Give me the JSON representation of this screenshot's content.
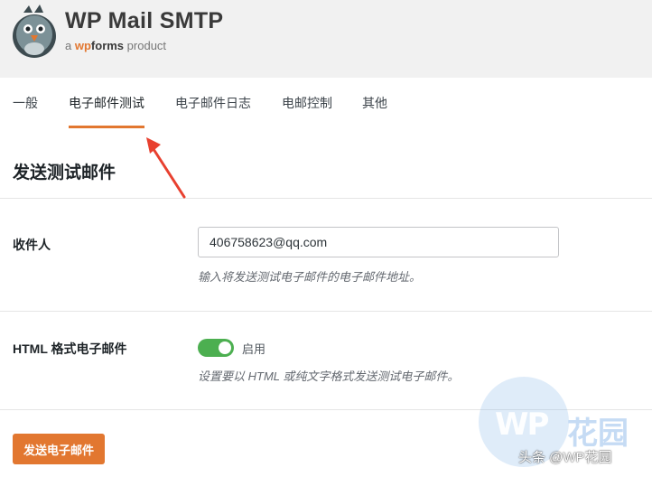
{
  "brand": {
    "title": "WP Mail SMTP",
    "sub_prefix": "a",
    "sub_wp": "wp",
    "sub_forms": "forms",
    "sub_suffix": "product"
  },
  "tabs": [
    {
      "label": "一般",
      "active": false
    },
    {
      "label": "电子邮件测试",
      "active": true
    },
    {
      "label": "电子邮件日志",
      "active": false
    },
    {
      "label": "电邮控制",
      "active": false
    },
    {
      "label": "其他",
      "active": false
    }
  ],
  "section_title": "发送测试邮件",
  "recipient": {
    "label": "收件人",
    "value": "406758623@qq.com",
    "description": "输入将发送测试电子邮件的电子邮件地址。"
  },
  "html_email": {
    "label": "HTML 格式电子邮件",
    "toggle_on": true,
    "toggle_label": "启用",
    "description": "设置要以 HTML 或纯文字格式发送测试电子邮件。"
  },
  "send_button": "发送电子邮件",
  "watermark": {
    "logo_left": "WP",
    "logo_right": "花园",
    "text": "头条 @WP花园"
  },
  "colors": {
    "accent": "#e27730",
    "toggle": "#4caf50",
    "annotation_arrow": "#e8402f"
  }
}
